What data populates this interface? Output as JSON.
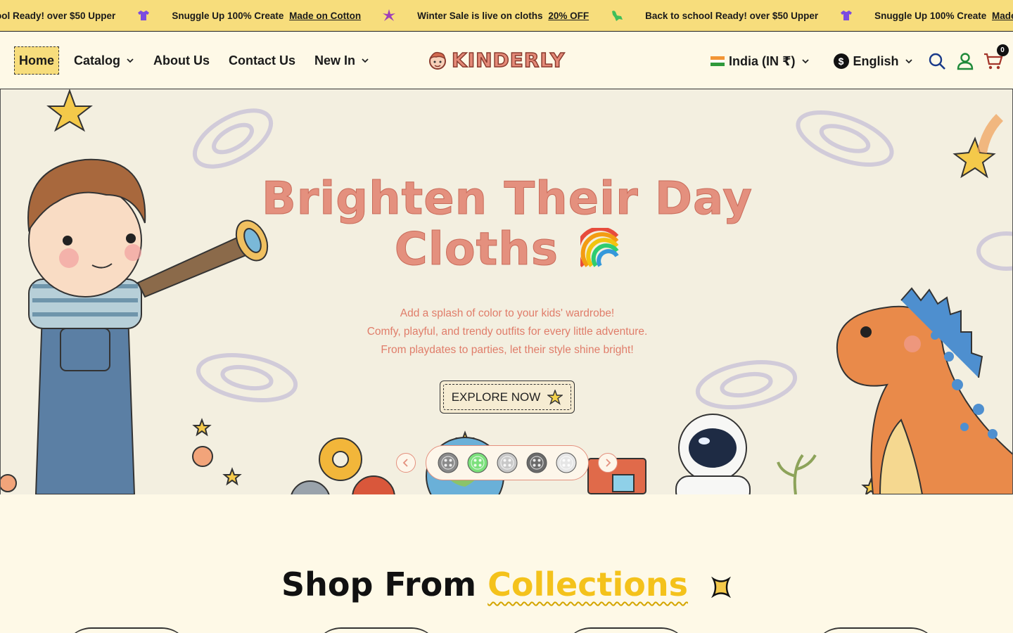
{
  "announcement": {
    "items": [
      {
        "text": "ool Ready! over $50 Upper",
        "link": ""
      },
      {
        "text": "Snuggle Up 100% Create",
        "link": "Made on Cotton"
      },
      {
        "text": "Winter Sale is live on cloths",
        "link": "20% OFF"
      },
      {
        "text": "Back to school Ready! over $50 Upper",
        "link": ""
      },
      {
        "text": "Snuggle Up 100% Create",
        "link": "Made on Cotton"
      }
    ],
    "icons": [
      "tshirt-icon",
      "star-icon",
      "dino-icon",
      "tshirt-icon",
      "star-icon"
    ]
  },
  "nav": {
    "home": "Home",
    "catalog": "Catalog",
    "about": "About Us",
    "contact": "Contact Us",
    "new_in": "New In"
  },
  "logo": {
    "text": "KINDERLY"
  },
  "tools": {
    "country": "India (IN ₹)",
    "language": "English",
    "cart_count": "0"
  },
  "hero": {
    "title_line1": "Brighten Their Day",
    "title_line2": "Cloths",
    "subtitle_line1": "Add a splash of color to your kids' wardrobe!",
    "subtitle_line2": "Comfy, playful, and trendy outfits for every little adventure.",
    "subtitle_line3": "From playdates to parties, let their style shine bright!",
    "cta": "EXPLORE NOW",
    "slides": [
      {
        "color": "#8a8a8a"
      },
      {
        "color": "#7be07b"
      },
      {
        "color": "#c8c8c8"
      },
      {
        "color": "#6a6a6a"
      },
      {
        "color": "#e6e6e6"
      }
    ],
    "active_slide": 2
  },
  "section": {
    "title_part1": "Shop From",
    "title_part2": "Collections"
  },
  "colors": {
    "accent_yellow": "#f7dd7c",
    "hero_text": "#e4907e",
    "background": "#fef9e7"
  }
}
